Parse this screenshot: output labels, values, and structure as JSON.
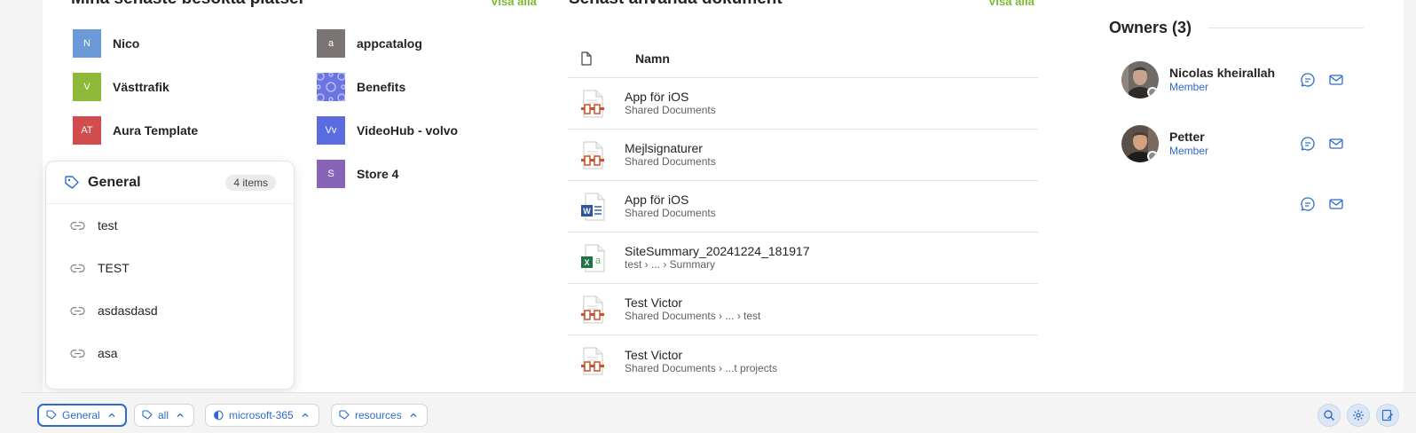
{
  "sites": {
    "title": "Mina senaste besökta platser",
    "see_all": "Visa alla",
    "items": [
      {
        "initials": "N",
        "name": "Nico",
        "color": "#6b9ad8"
      },
      {
        "initials": "V",
        "name": "Västtrafik",
        "color": "#8db83a"
      },
      {
        "initials": "AT",
        "name": "Aura Template",
        "color": "#d14c4c"
      },
      {
        "initials": "a",
        "name": "appcatalog",
        "color": "#7a7574"
      },
      {
        "initials": "",
        "name": "Benefits",
        "color": "#6c74e0"
      },
      {
        "initials": "Vv",
        "name": "VideoHub - volvo",
        "color": "#5b6be0"
      },
      {
        "initials": "S",
        "name": "Store 4",
        "color": "#8764b8"
      }
    ]
  },
  "documents": {
    "title": "Senast använda dokument",
    "see_all": "Visa alla",
    "column_name": "Namn",
    "rows": [
      {
        "title": "App för iOS",
        "path": "Shared Documents",
        "icon": "generic-file-icon"
      },
      {
        "title": "Mejlsignaturer",
        "path": "Shared Documents",
        "icon": "generic-file-icon"
      },
      {
        "title": "App för iOS",
        "path": "Shared Documents",
        "icon": "word-file-icon"
      },
      {
        "title": "SiteSummary_20241224_181917",
        "path": "test › ... › Summary",
        "icon": "excel-file-icon"
      },
      {
        "title": "Test Victor",
        "path": "Shared Documents › ... › test",
        "icon": "generic-file-icon"
      },
      {
        "title": "Test Victor",
        "path": "Shared Documents › ...t projects",
        "icon": "generic-file-icon"
      }
    ]
  },
  "owners": {
    "title": "Owners (3)",
    "items": [
      {
        "name": "Nicolas kheirallah",
        "role": "Member"
      },
      {
        "name": "Petter",
        "role": "Member"
      },
      {
        "name": "",
        "role": ""
      }
    ]
  },
  "popup": {
    "title": "General",
    "count": "4 items",
    "items": [
      "test",
      "TEST",
      "asdasdasd",
      "asa"
    ]
  },
  "bottombar": {
    "chips": [
      "General",
      "all",
      "microsoft-365",
      "resources"
    ],
    "active_chip": "General",
    "tools": [
      "search-icon",
      "gear-icon",
      "edit-icon"
    ]
  },
  "colors": {
    "accent": "#2f6bcb",
    "see_all": "#7cb82f"
  }
}
